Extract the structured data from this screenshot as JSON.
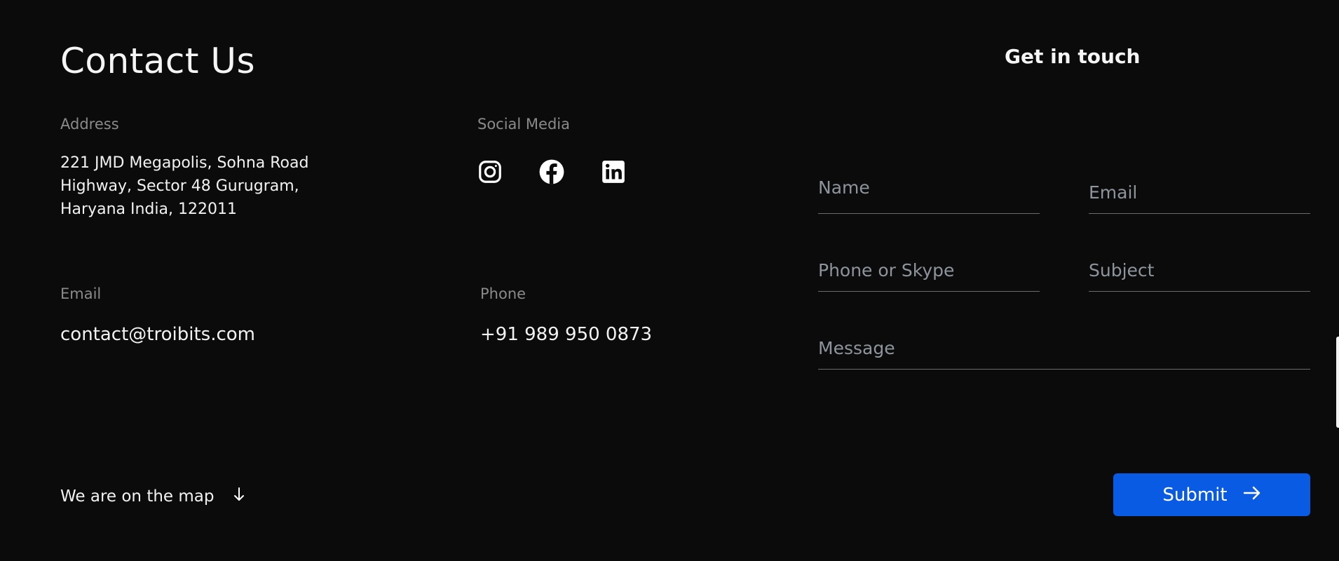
{
  "contact": {
    "title": "Contact Us",
    "address_label": "Address",
    "address_lines": [
      "221 JMD Megapolis, Sohna Road",
      "Highway, Sector 48 Gurugram,",
      "Haryana India, 122011"
    ],
    "social_label": "Social Media",
    "social_icons": [
      "instagram-icon",
      "facebook-icon",
      "linkedin-icon"
    ],
    "email_label": "Email",
    "email_value": "contact@troibits.com",
    "phone_label": "Phone",
    "phone_value": "+91 989 950 0873",
    "map_link": "We are on the map",
    "map_icon": "arrow-down-icon"
  },
  "form": {
    "title": "Get in touch",
    "name_placeholder": "Name",
    "email_placeholder": "Email",
    "phone_placeholder": "Phone or Skype",
    "subject_placeholder": "Subject",
    "message_placeholder": "Message",
    "submit_label": "Submit",
    "submit_icon": "arrow-right-icon"
  },
  "colors": {
    "background": "#0b0b0b",
    "accent": "#0a5be3",
    "muted_label": "#8a8a8a",
    "placeholder": "#8d949b"
  }
}
